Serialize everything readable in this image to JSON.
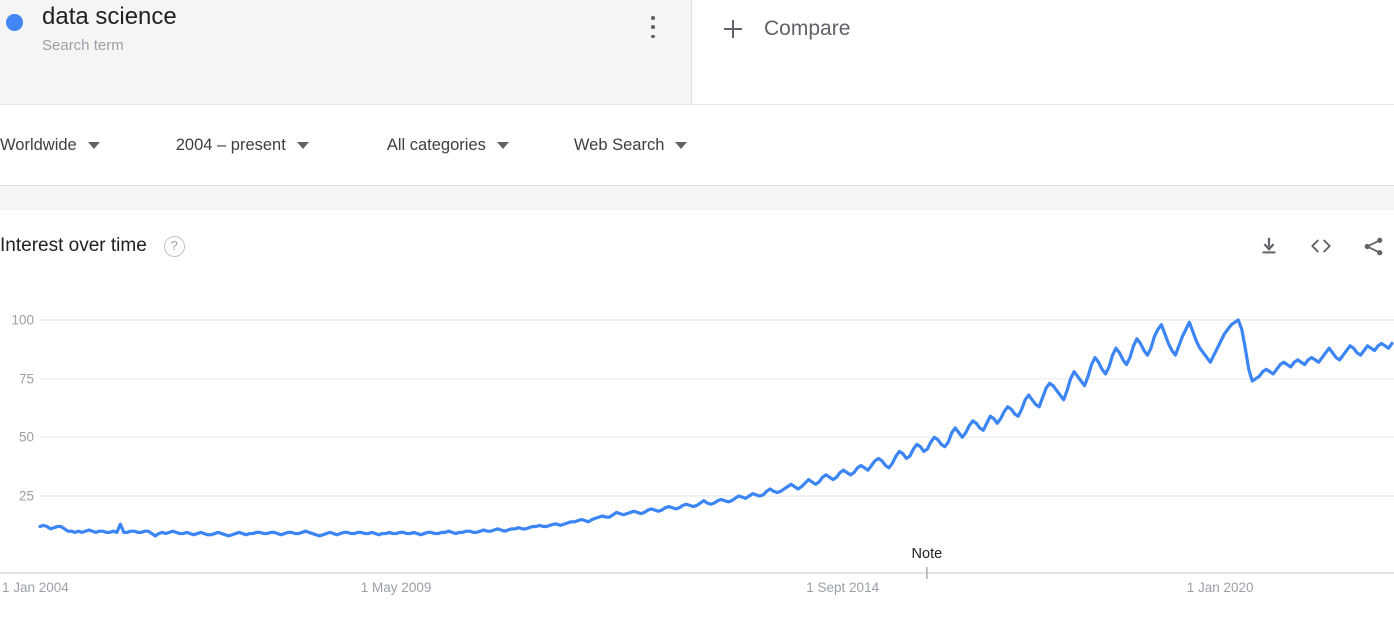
{
  "search_term": {
    "title": "data science",
    "subtitle": "Search term",
    "dot_color": "#4285f4",
    "menu_icon": "kebab-menu-icon"
  },
  "compare": {
    "label": "Compare",
    "icon": "plus-icon"
  },
  "filters": [
    {
      "label": "Worldwide",
      "name": "location-filter"
    },
    {
      "label": "2004 – present",
      "name": "time-range-filter"
    },
    {
      "label": "All categories",
      "name": "category-filter"
    },
    {
      "label": "Web Search",
      "name": "search-type-filter"
    }
  ],
  "interest_over_time": {
    "title": "Interest over time",
    "help_glyph": "?",
    "actions": [
      {
        "name": "download-icon",
        "tooltip": "Download"
      },
      {
        "name": "embed-code-icon",
        "tooltip": "Embed"
      },
      {
        "name": "share-icon",
        "tooltip": "Share"
      }
    ]
  },
  "chart_data": {
    "type": "line",
    "title": "Interest over time",
    "xlabel": "",
    "ylabel": "",
    "ylim": [
      0,
      107
    ],
    "yticks": [
      25,
      50,
      75,
      100
    ],
    "ytick_labels": [
      "25",
      "50",
      "75",
      "100"
    ],
    "grid": true,
    "legend": false,
    "line_color": "#3b85f5",
    "xtick_labels": [
      "1 Jan 2004",
      "1 May 2009",
      "1 Sept 2014",
      "1 Jan 2020"
    ],
    "xtick_positions": [
      0.0,
      0.265,
      0.594,
      0.875
    ],
    "annotations": [
      {
        "label": "Note",
        "x_fraction": 0.655
      }
    ],
    "series": [
      {
        "name": "data science",
        "values": [
          12,
          12.5,
          12,
          11,
          11.5,
          12,
          12,
          11,
          10,
          10,
          9.5,
          10,
          9.5,
          10,
          10.5,
          10,
          9.5,
          10,
          10,
          9.5,
          9.5,
          10,
          9.5,
          13,
          9.5,
          9.5,
          10,
          10,
          9.5,
          9.5,
          10,
          10,
          9,
          8,
          9,
          9.5,
          9,
          9.5,
          10,
          9.5,
          9,
          9,
          9.5,
          9,
          8.5,
          9,
          9.5,
          9,
          8.5,
          8.5,
          9,
          9.5,
          9,
          8.5,
          8,
          8.5,
          9,
          9.5,
          9,
          8.5,
          9,
          9,
          9.5,
          9.5,
          9,
          9,
          9.5,
          9.5,
          9,
          8.5,
          9,
          9.5,
          9.5,
          9,
          9,
          9.5,
          10,
          9.5,
          9,
          8.5,
          8,
          8.5,
          9,
          9.5,
          9,
          8.5,
          9,
          9.5,
          9.5,
          9,
          9,
          9.5,
          9.5,
          9,
          9,
          9.5,
          9,
          8.5,
          9,
          9,
          9.5,
          9,
          9,
          9.5,
          9.5,
          9,
          9,
          9.5,
          9,
          8.5,
          9,
          9.5,
          9.5,
          9,
          9,
          9.5,
          9.5,
          10,
          9.5,
          9,
          9.5,
          9.5,
          10,
          10,
          9.5,
          9.5,
          10,
          10.5,
          10,
          10,
          10.5,
          11,
          10.5,
          10,
          10.5,
          11,
          11,
          11.5,
          11,
          11,
          11.5,
          12,
          12,
          12.5,
          12,
          12,
          12.5,
          13,
          13,
          12.5,
          13,
          13.5,
          14,
          14,
          14.5,
          15,
          14.5,
          14,
          15,
          15.5,
          16,
          16.5,
          16,
          16,
          17,
          18,
          17.5,
          17,
          17.5,
          18,
          18.5,
          18,
          17.5,
          18,
          19,
          19.5,
          19,
          18.5,
          19,
          20,
          20.5,
          20,
          19.5,
          20,
          21,
          21.5,
          21,
          20.5,
          21,
          22,
          23,
          22,
          21.5,
          22,
          23,
          23.5,
          23,
          22.5,
          23,
          24,
          25,
          24.5,
          24,
          25,
          26,
          25.5,
          25,
          25.5,
          27,
          28,
          27,
          26.5,
          27,
          28,
          29,
          30,
          29,
          28,
          29,
          30.5,
          32,
          31,
          30,
          31,
          33,
          34,
          33,
          32,
          33,
          35,
          36,
          35,
          34,
          35,
          37,
          38,
          37,
          36,
          38,
          40,
          41,
          40,
          38,
          37,
          39,
          42,
          44,
          43,
          41,
          42,
          45,
          47,
          46,
          44,
          45,
          48,
          50,
          49,
          47,
          46,
          48,
          52,
          54,
          52,
          50,
          52,
          55,
          57,
          56,
          54,
          53,
          56,
          59,
          58,
          56,
          58,
          61,
          63,
          62,
          60,
          59,
          62,
          66,
          68,
          66,
          64,
          63,
          67,
          71,
          73,
          72,
          70,
          68,
          66,
          70,
          75,
          78,
          76,
          74,
          72,
          76,
          81,
          84,
          82,
          79,
          77,
          80,
          85,
          88,
          86,
          83,
          81,
          84,
          89,
          92,
          90,
          87,
          85,
          88,
          93,
          96,
          98,
          94,
          90,
          87,
          85,
          89,
          93,
          96,
          99,
          95,
          91,
          88,
          86,
          84,
          82,
          85,
          88,
          91,
          94,
          96,
          98,
          99,
          100,
          96,
          88,
          79,
          74,
          75,
          76,
          78,
          79,
          78,
          77,
          79,
          81,
          82,
          81,
          80,
          82,
          83,
          82,
          81,
          83,
          84,
          83,
          82,
          84,
          86,
          88,
          86,
          84,
          83,
          85,
          87,
          89,
          88,
          86,
          85,
          87,
          89,
          88,
          87,
          89,
          90,
          89,
          88,
          90
        ]
      }
    ]
  }
}
